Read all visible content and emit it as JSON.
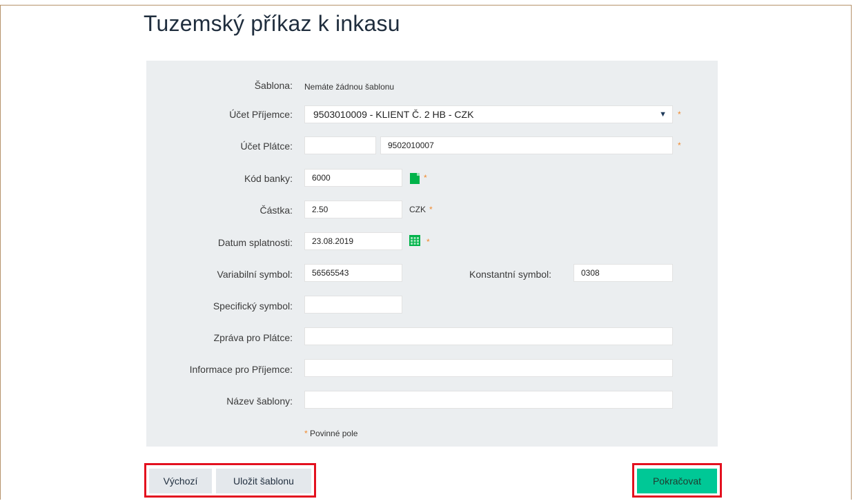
{
  "page": {
    "title": "Tuzemský příkaz k inkasu"
  },
  "form": {
    "sablona": {
      "label": "Šablona:",
      "value": "Nemáte žádnou šablonu"
    },
    "ucet_prijemce": {
      "label": "Účet Příjemce:",
      "value": "9503010009 - KLIENT Č. 2 HB - CZK"
    },
    "ucet_platce": {
      "label": "Účet Plátce:",
      "prefix": "",
      "number": "9502010007"
    },
    "kod_banky": {
      "label": "Kód banky:",
      "value": "6000"
    },
    "castka": {
      "label": "Částka:",
      "value": "2.50",
      "currency": "CZK"
    },
    "datum_splatnosti": {
      "label": "Datum splatnosti:",
      "value": "23.08.2019"
    },
    "variabilni_symbol": {
      "label": "Variabilní symbol:",
      "value": "56565543"
    },
    "konstantni_symbol": {
      "label": "Konstantní symbol:",
      "value": "0308"
    },
    "specificky_symbol": {
      "label": "Specifický symbol:",
      "value": ""
    },
    "zprava_pro_platce": {
      "label": "Zpráva pro Plátce:",
      "value": ""
    },
    "informace_pro_prijemce": {
      "label": "Informace pro Příjemce:",
      "value": ""
    },
    "nazev_sablony": {
      "label": "Název šablony:",
      "value": ""
    },
    "required_mark": "*",
    "required_note": "Povinné pole"
  },
  "buttons": {
    "default": "Výchozí",
    "save_template": "Uložit šablonu",
    "continue": "Pokračovat"
  },
  "colors": {
    "accent": "#00c896",
    "required": "#f08a2e",
    "highlight": "#e3101e",
    "panel": "#ebeef0"
  },
  "icons": {
    "bank_book": "address-book-icon",
    "calendar": "calendar-icon"
  }
}
